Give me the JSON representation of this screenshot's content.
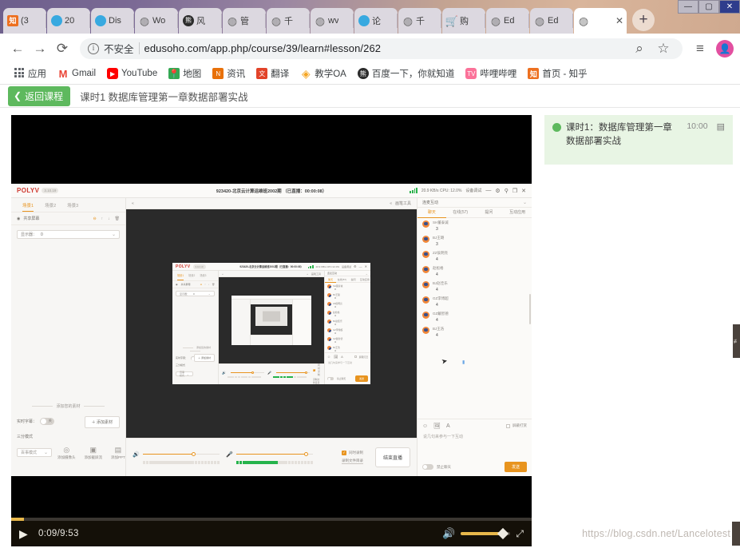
{
  "window": {
    "minimize": "—",
    "maximize": "▢",
    "close": "✕"
  },
  "browser": {
    "tabs": [
      {
        "favicon": "zhihu-icon",
        "title": "(3"
      },
      {
        "favicon": "blue-bird-icon",
        "title": "20"
      },
      {
        "favicon": "blue-bird-icon",
        "title": "Dis"
      },
      {
        "favicon": "globe-icon",
        "title": "Wo"
      },
      {
        "favicon": "baidu-icon",
        "title": "风"
      },
      {
        "favicon": "globe-icon",
        "title": "管"
      },
      {
        "favicon": "globe-icon",
        "title": "千"
      },
      {
        "favicon": "globe-icon",
        "title": "wv"
      },
      {
        "favicon": "blue-bird-icon",
        "title": "论"
      },
      {
        "favicon": "globe-icon",
        "title": "千"
      },
      {
        "favicon": "cart-icon",
        "title": "购"
      },
      {
        "favicon": "globe-icon",
        "title": "Ed"
      },
      {
        "favicon": "globe-icon",
        "title": "Ed"
      },
      {
        "favicon": "globe-icon",
        "title": "",
        "active": true,
        "close": "✕"
      }
    ],
    "new_tab_label": "+",
    "nav": {
      "back": "←",
      "forward": "→",
      "reload": "⟳",
      "info_icon": "i",
      "security_label": "不安全",
      "url": "edusoho.com/app.php/course/39/learn#lesson/262",
      "zoom_icon": "⌕",
      "bookmark_icon": "☆",
      "reading_list_icon": "≡",
      "profile_icon": "👤"
    },
    "bookmarks": [
      {
        "icon": "apps-grid-icon",
        "label": "应用"
      },
      {
        "icon": "gmail-icon",
        "label": "Gmail"
      },
      {
        "icon": "youtube-icon",
        "label": "YouTube"
      },
      {
        "icon": "maps-icon",
        "label": "地图"
      },
      {
        "icon": "news-icon",
        "label": "资讯"
      },
      {
        "icon": "translate-icon",
        "label": "翻译"
      },
      {
        "icon": "oa-icon",
        "label": "教学OA"
      },
      {
        "icon": "baidu-icon",
        "label": "百度一下，你就知道"
      },
      {
        "icon": "bilibili-icon",
        "label": "哔哩哔哩"
      },
      {
        "icon": "zhihu-icon",
        "label": "首页 - 知乎"
      }
    ]
  },
  "course": {
    "back_button": "返回课程",
    "back_chevron": "❮",
    "title": "课时1  数据库管理第一章数据部署实战"
  },
  "lesson_panel": {
    "title": "课时1：数据库管理第一章数据部署实战",
    "duration": "10:00",
    "doc_icon": "▤"
  },
  "player": {
    "play_icon": "▶",
    "time": "0:09/9:53",
    "volume_icon": "🔊",
    "fullscreen_icon": "⤢",
    "progress_percent": 2.5,
    "volume_percent": 80
  },
  "watermark": "https://blog.csdn.net/Lancelotest",
  "edge_handle": "≢",
  "polyv": {
    "logo": "POLYV",
    "version": "3.10.19",
    "room_title": "923420-北京云计算运维班2002期 （已直播：00:00:08）",
    "network": "20.9 KB/s CPU: 12.0%",
    "device_test": "设备调试",
    "win_buttons": [
      "⤡",
      "⚙",
      "⚲",
      "—",
      "❐",
      "✕"
    ],
    "left": {
      "scenes": [
        "场景1",
        "场景2",
        "场景3"
      ],
      "layer_label": "共享屏幕",
      "layer_eye_icon": "◉",
      "layer_actions": [
        "⊖",
        "↑",
        "↓",
        "🗑"
      ],
      "display_label": "显示器：",
      "display_value": "0",
      "add_material_divider": "添加您的素材",
      "subtitle_label": "实时字幕：",
      "subtitle_state": "关",
      "add_material_button": "＋ 添加素材",
      "mode_label": "三分模式",
      "mode_value": "百事模式",
      "icon_buttons": [
        {
          "icon": "camera-icon",
          "label": "添加摄像头"
        },
        {
          "icon": "screen-icon",
          "label": "添加截屏流"
        },
        {
          "icon": "ppt-icon",
          "label": "添加PPT"
        }
      ]
    },
    "center": {
      "collapse_left": "«",
      "collapse_right": "«",
      "paint_tools": "画笔工具"
    },
    "bottom": {
      "speaker_icon": "🔊",
      "mic_icon": "🎤",
      "record_checkbox": "同时录制",
      "record_link": "录制文件目录",
      "end_button": "结束直播"
    },
    "right": {
      "select_value": "连麦互动",
      "tabs": [
        "聊天",
        "在线(57)",
        "提问",
        "互动应用"
      ],
      "active_tab": "聊天",
      "messages": [
        {
          "name": "SH董泰诚",
          "text": "3"
        },
        {
          "name": "BJ王璐",
          "text": "3"
        },
        {
          "name": "ZZ侯明亮",
          "text": "4"
        },
        {
          "name": "赵松格",
          "text": "4"
        },
        {
          "name": "BJ赵佳乐",
          "text": "4"
        },
        {
          "name": "GZ李博超",
          "text": "4"
        },
        {
          "name": "GZ戴智德",
          "text": "4"
        },
        {
          "name": "BJ王浩",
          "text": "4"
        }
      ],
      "tools": [
        "emoji-icon",
        "image-icon",
        "font-icon"
      ],
      "shield_checkbox": "屏蔽打赏",
      "input_placeholder": "说几句来参与一下互动",
      "mute_toggle": "禁止聊天",
      "send_button": "发送"
    }
  }
}
